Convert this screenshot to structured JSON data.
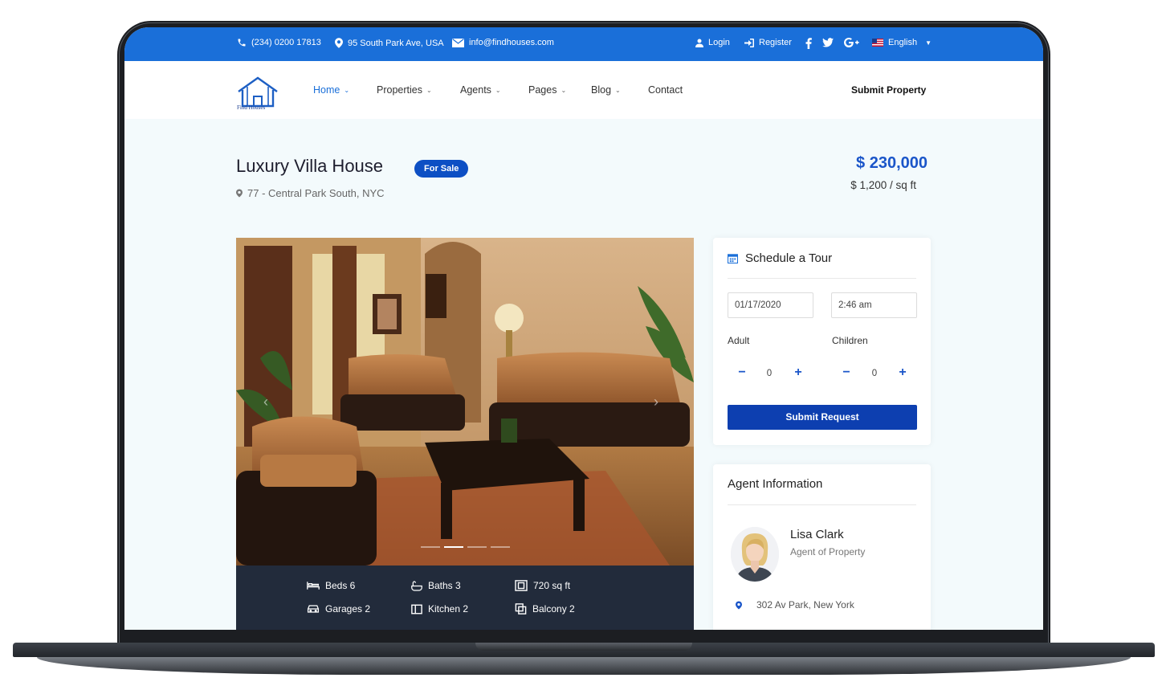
{
  "topbar": {
    "phone": "(234) 0200 17813",
    "address": "95 South Park Ave, USA",
    "email": "info@findhouses.com",
    "login": "Login",
    "register": "Register",
    "language": "English",
    "social_icons": [
      "facebook-icon",
      "twitter-icon",
      "google-plus-icon"
    ]
  },
  "header": {
    "logo_text": "Find Houses",
    "nav": [
      {
        "label": "Home",
        "active": true
      },
      {
        "label": "Properties"
      },
      {
        "label": "Agents"
      },
      {
        "label": "Pages"
      },
      {
        "label": "Blog"
      },
      {
        "label": "Contact"
      }
    ],
    "submit_property": "Submit Property"
  },
  "listing": {
    "title": "Luxury Villa House",
    "badge": "For Sale",
    "address": "77 - Central Park South, NYC",
    "price": "$ 230,000",
    "price_per_sqft": "$ 1,200 / sq ft"
  },
  "gallery": {
    "slides": 4,
    "active_slide": 2
  },
  "features": [
    {
      "icon": "bed-icon",
      "label": "Beds 6"
    },
    {
      "icon": "bath-icon",
      "label": "Baths 3"
    },
    {
      "icon": "area-icon",
      "label": "720 sq ft"
    },
    {
      "icon": "car-icon",
      "label": "Garages 2"
    },
    {
      "icon": "kitchen-icon",
      "label": "Kitchen 2"
    },
    {
      "icon": "balcony-icon",
      "label": "Balcony 2"
    }
  ],
  "tour": {
    "title": "Schedule a Tour",
    "date": "01/17/2020",
    "time": "2:46 am",
    "adult_label": "Adult",
    "adult_value": "0",
    "children_label": "Children",
    "children_value": "0",
    "submit": "Submit Request"
  },
  "agent": {
    "section_title": "Agent Information",
    "name": "Lisa Clark",
    "role": "Agent of Property",
    "address": "302 Av Park, New York"
  },
  "colors": {
    "primary": "#1a6fd9",
    "button": "#0d3fb0",
    "badge": "#0d4fc4",
    "price": "#1a55c9",
    "features_bg": "#222b3b",
    "page_bg": "#f3fafc"
  }
}
